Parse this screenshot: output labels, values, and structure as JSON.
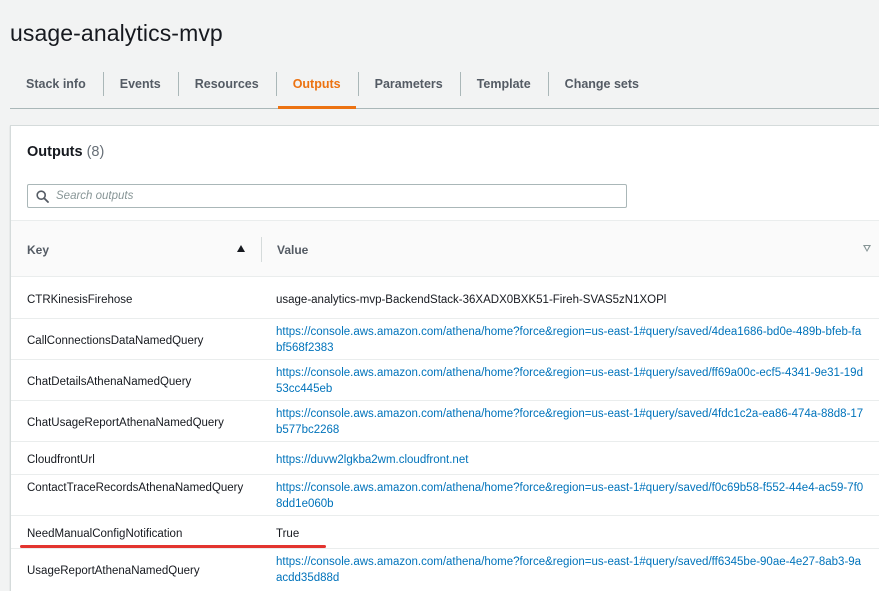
{
  "page": {
    "title": "usage-analytics-mvp"
  },
  "tabs": [
    {
      "label": "Stack info",
      "active": false
    },
    {
      "label": "Events",
      "active": false
    },
    {
      "label": "Resources",
      "active": false
    },
    {
      "label": "Outputs",
      "active": true
    },
    {
      "label": "Parameters",
      "active": false
    },
    {
      "label": "Template",
      "active": false
    },
    {
      "label": "Change sets",
      "active": false
    }
  ],
  "outputs": {
    "title": "Outputs",
    "count": "(8)",
    "search_placeholder": "Search outputs",
    "columns": {
      "key": "Key",
      "value": "Value"
    },
    "rows": [
      {
        "key": "CTRKinesisFirehose",
        "value": "usage-analytics-mvp-BackendStack-36XADX0BXK51-Fireh-SVAS5zN1XOPl",
        "is_link": false
      },
      {
        "key": "CallConnectionsDataNamedQuery",
        "value": "https://console.aws.amazon.com/athena/home?force&region=us-east-1#query/saved/4dea1686-bd0e-489b-bfeb-fabf568f2383",
        "is_link": true
      },
      {
        "key": "ChatDetailsAthenaNamedQuery",
        "value": "https://console.aws.amazon.com/athena/home?force&region=us-east-1#query/saved/ff69a00c-ecf5-4341-9e31-19d53cc445eb",
        "is_link": true
      },
      {
        "key": "ChatUsageReportAthenaNamedQuery",
        "value": "https://console.aws.amazon.com/athena/home?force&region=us-east-1#query/saved/4fdc1c2a-ea86-474a-88d8-17b577bc2268",
        "is_link": true
      },
      {
        "key": "CloudfrontUrl",
        "value": "https://duvw2lgkba2wm.cloudfront.net",
        "is_link": true
      },
      {
        "key": "ContactTraceRecordsAthenaNamedQuery",
        "value": "https://console.aws.amazon.com/athena/home?force&region=us-east-1#query/saved/f0c69b58-f552-44e4-ac59-7f08dd1e060b",
        "is_link": true
      },
      {
        "key": "NeedManualConfigNotification",
        "value": "True",
        "is_link": false
      },
      {
        "key": "UsageReportAthenaNamedQuery",
        "value": "https://console.aws.amazon.com/athena/home?force&region=us-east-1#query/saved/ff6345be-90ae-4e27-8ab3-9aacdd35d88d",
        "is_link": true
      }
    ]
  },
  "colors": {
    "accent": "#ec7211",
    "link": "#0073bb",
    "highlight": "#e3342f"
  }
}
